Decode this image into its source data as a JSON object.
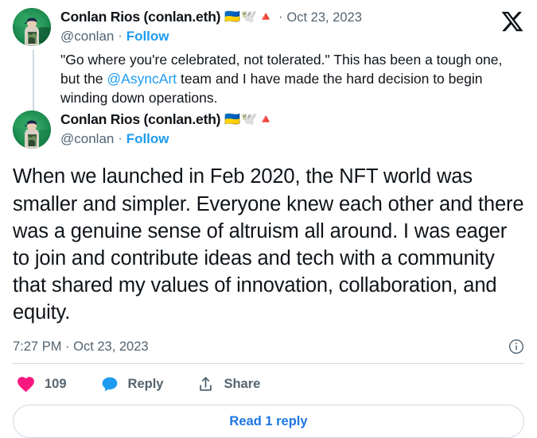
{
  "brand": {
    "logo_icon": "x-logo-icon",
    "link_color": "#1d9bf0",
    "text_color": "#0f1419",
    "muted_color": "#536471",
    "like_color": "#f91880",
    "reply_color": "#1d9bf0",
    "border_color": "#cfd9de"
  },
  "posts": [
    {
      "avatar_icon": "user-avatar-conlan",
      "display_name": "Conlan Rios (conlan.eth)",
      "badges": "🇺🇦🕊️🔺",
      "separator": "·",
      "date": "Oct 23, 2023",
      "handle": "@conlan",
      "handle_separator": "·",
      "follow_label": "Follow",
      "text_part_1": "\"Go where you're celebrated, not tolerated.\" This has been a tough one, but the ",
      "mention": "@AsyncArt",
      "text_part_2": " team and I have made the hard decision to begin winding down operations."
    },
    {
      "avatar_icon": "user-avatar-conlan",
      "display_name": "Conlan Rios (conlan.eth)",
      "badges": "🇺🇦🕊️🔺",
      "handle": "@conlan",
      "handle_separator": "·",
      "follow_label": "Follow",
      "main_text": "When we launched in Feb 2020, the NFT world was smaller and simpler. Everyone knew each other and there was a genuine sense of altruism all around. I was eager to join and contribute ideas and tech with a community that shared my values of innovation, collaboration, and equity."
    }
  ],
  "meta": {
    "timestamp": "7:27 PM · Oct 23, 2023",
    "info_icon": "info-circle-icon"
  },
  "actions": {
    "like": {
      "icon": "heart-icon",
      "count": "109"
    },
    "reply": {
      "icon": "speech-bubble-icon",
      "label": "Reply"
    },
    "share": {
      "icon": "share-arrow-icon",
      "label": "Share"
    }
  },
  "footer": {
    "read_replies_label": "Read 1 reply"
  }
}
